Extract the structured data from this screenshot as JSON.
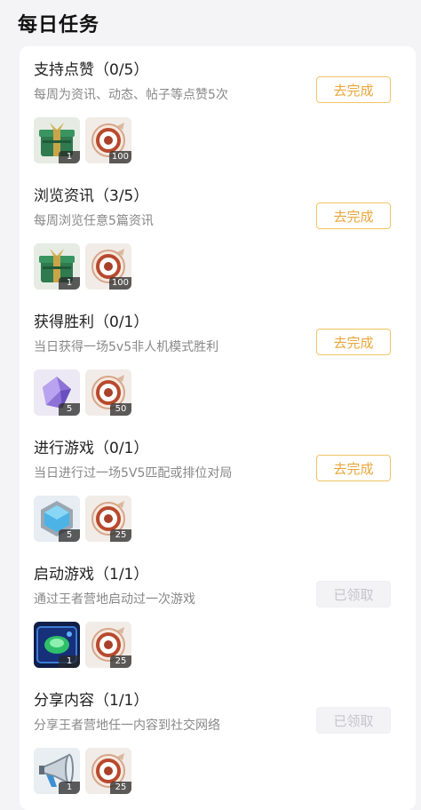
{
  "header": {
    "title": "每日任务"
  },
  "tasks": [
    {
      "name": "支持点赞（0/5）",
      "desc": "每周为资讯、动态、帖子等点赞5次",
      "action": "去完成",
      "rewards": [
        {
          "icon": "green-chest-icon",
          "count": "1"
        },
        {
          "icon": "target-icon",
          "count": "100"
        }
      ]
    },
    {
      "name": "浏览资讯（3/5）",
      "desc": "每周浏览任意5篇资讯",
      "action": "去完成",
      "rewards": [
        {
          "icon": "green-chest-icon",
          "count": "1"
        },
        {
          "icon": "target-icon",
          "count": "100"
        }
      ]
    },
    {
      "name": "获得胜利（0/1）",
      "desc": "当日获得一场5v5非人机模式胜利",
      "action": "去完成",
      "rewards": [
        {
          "icon": "purple-crystal-icon",
          "count": "5"
        },
        {
          "icon": "target-icon",
          "count": "50"
        }
      ]
    },
    {
      "name": "进行游戏（0/1）",
      "desc": "当日进行过一场5V5匹配或排位对局",
      "action": "去完成",
      "rewards": [
        {
          "icon": "blue-hexagon-gem-icon",
          "count": "5"
        },
        {
          "icon": "target-icon",
          "count": "25"
        }
      ]
    },
    {
      "name": "启动游戏（1/1）",
      "desc": "通过王者营地启动过一次游戏",
      "action": "已领取",
      "rewards": [
        {
          "icon": "green-card-icon",
          "count": "1"
        },
        {
          "icon": "target-icon",
          "count": "25"
        }
      ]
    },
    {
      "name": "分享内容（1/1）",
      "desc": "分享王者营地任一内容到社交网络",
      "action": "已领取",
      "rewards": [
        {
          "icon": "megaphone-icon",
          "count": "1"
        },
        {
          "icon": "target-icon",
          "count": "25"
        }
      ]
    }
  ]
}
